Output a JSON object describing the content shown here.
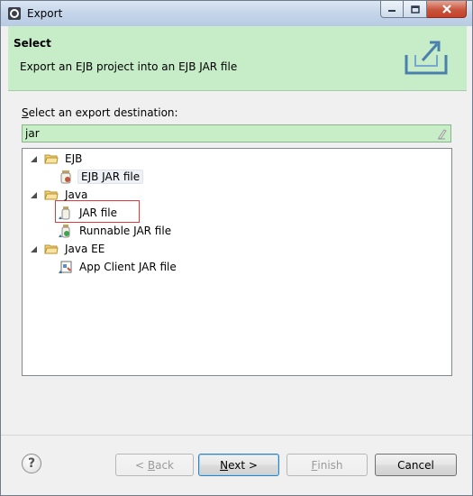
{
  "window": {
    "title": "Export"
  },
  "banner": {
    "title": "Select",
    "description": "Export an EJB project into an EJB JAR file"
  },
  "content": {
    "destination_label_prefix": "S",
    "destination_label_rest": "elect an export destination:",
    "filter_value": "jar"
  },
  "tree": {
    "ejb_group": "EJB",
    "ejb_jar": "EJB JAR file",
    "java_group": "Java",
    "jar_file": "JAR file",
    "runnable_jar": "Runnable JAR file",
    "javaee_group": "Java EE",
    "app_client_jar": "App Client JAR file"
  },
  "buttons": {
    "help": "?",
    "back_prefix": "< ",
    "back_mnemonic": "B",
    "back_rest": "ack",
    "next_mnemonic": "N",
    "next_rest": "ext >",
    "finish_mnemonic": "F",
    "finish_rest": "inish",
    "cancel": "Cancel"
  },
  "colors": {
    "banner_bg": "#c6ecc8",
    "filter_bg": "#c8eec8",
    "highlight": "#e03a3a"
  },
  "icons": [
    "eclipse-app-icon",
    "minimize-icon",
    "maximize-icon",
    "close-icon",
    "export-icon",
    "clear-icon",
    "folder-icon",
    "jar-icon",
    "help-icon"
  ]
}
